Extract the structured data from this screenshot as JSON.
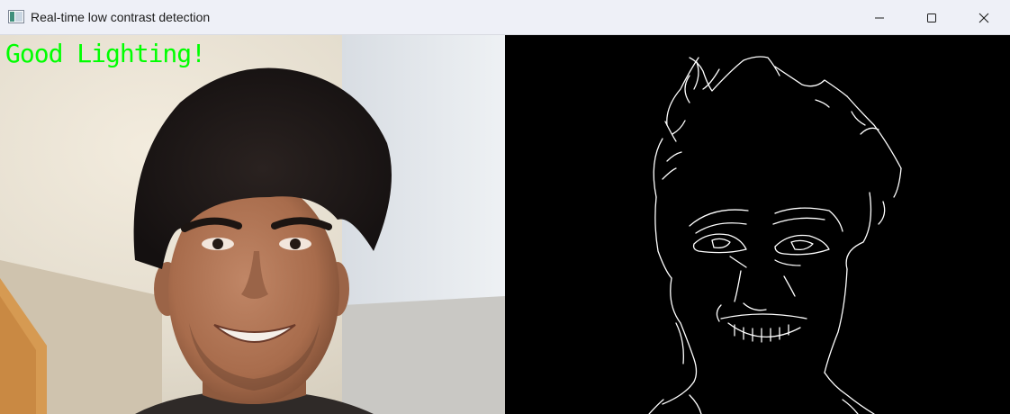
{
  "window": {
    "title": "Real-time low contrast detection",
    "app_icon": "opencv-window-icon",
    "controls": {
      "minimize_icon": "minimize-icon",
      "maximize_icon": "maximize-icon",
      "close_icon": "close-icon"
    }
  },
  "camera": {
    "status_text": "Good Lighting!",
    "status_color": "#00ff00"
  },
  "edges": {
    "background": "#000000",
    "line_color": "#ffffff"
  }
}
